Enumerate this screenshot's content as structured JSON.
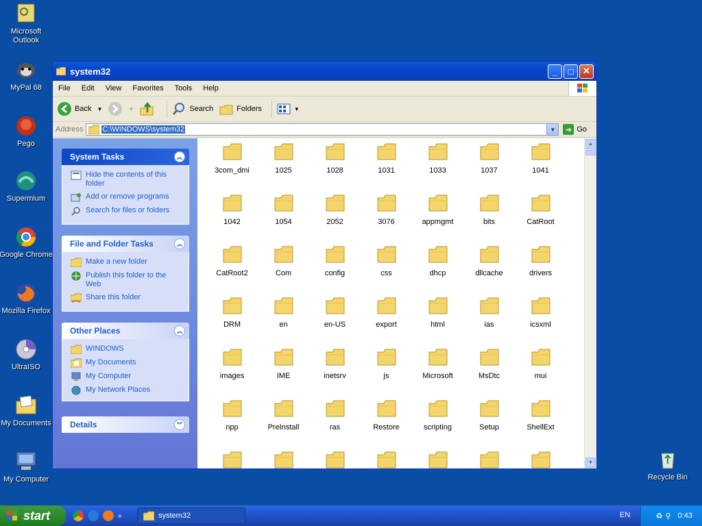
{
  "desktop": {
    "icons": [
      {
        "label": "Microsoft Outlook"
      },
      {
        "label": "MyPal 68"
      },
      {
        "label": "Pego"
      },
      {
        "label": "Supermium"
      },
      {
        "label": "Google Chrome"
      },
      {
        "label": "Mozilla Firefox"
      },
      {
        "label": "UltraISO"
      },
      {
        "label": "My Documents"
      },
      {
        "label": "My Computer"
      }
    ],
    "recycle_bin": "Recycle Bin"
  },
  "window": {
    "title": "system32",
    "menu": [
      "File",
      "Edit",
      "View",
      "Favorites",
      "Tools",
      "Help"
    ],
    "toolbar": {
      "back": "Back",
      "search": "Search",
      "folders": "Folders"
    },
    "address": {
      "label": "Address",
      "path": "C:\\WINDOWS\\system32",
      "go": "Go"
    }
  },
  "sidebar": {
    "system_tasks": {
      "title": "System Tasks",
      "items": [
        "Hide the contents of this folder",
        "Add or remove programs",
        "Search for files or folders"
      ]
    },
    "file_tasks": {
      "title": "File and Folder Tasks",
      "items": [
        "Make a new folder",
        "Publish this folder to the Web",
        "Share this folder"
      ]
    },
    "other_places": {
      "title": "Other Places",
      "items": [
        "WINDOWS",
        "My Documents",
        "My Computer",
        "My Network Places"
      ]
    },
    "details": {
      "title": "Details"
    }
  },
  "folders": [
    "3com_dmi",
    "1025",
    "1028",
    "1031",
    "1033",
    "1037",
    "1041",
    "1042",
    "1054",
    "2052",
    "3076",
    "appmgmt",
    "bits",
    "CatRoot",
    "CatRoot2",
    "Com",
    "config",
    "css",
    "dhcp",
    "dllcache",
    "drivers",
    "DRM",
    "en",
    "en-US",
    "export",
    "html",
    "ias",
    "icsxml",
    "images",
    "IME",
    "inetsrv",
    "js",
    "Microsoft",
    "MsDtc",
    "mui",
    "npp",
    "PreInstall",
    "ras",
    "Restore",
    "scripting",
    "Setup",
    "ShellExt"
  ],
  "taskbar": {
    "start": "start",
    "task": "system32",
    "lang": "EN",
    "clock": "0:43"
  },
  "colors": {
    "folder": "#f3d56b",
    "link": "#215dc6",
    "desktop": "#0a4da4"
  }
}
